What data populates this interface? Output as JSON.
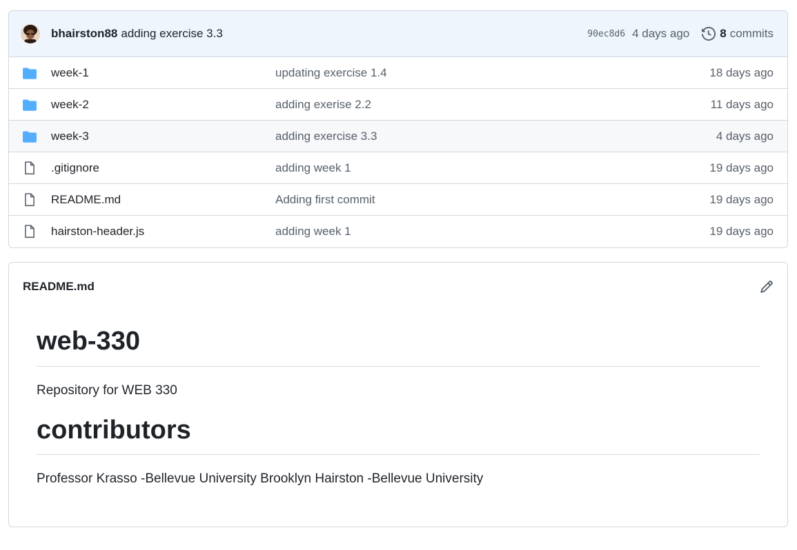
{
  "latest_commit": {
    "author": "bhairston88",
    "message": "adding exercise 3.3",
    "sha": "90ec8d6",
    "time": "4 days ago",
    "commit_count": "8",
    "commits_label": "commits"
  },
  "files": [
    {
      "type": "folder",
      "name": "week-1",
      "commit": "updating exercise 1.4",
      "age": "18 days ago"
    },
    {
      "type": "folder",
      "name": "week-2",
      "commit": "adding exerise 2.2",
      "age": "11 days ago"
    },
    {
      "type": "folder",
      "name": "week-3",
      "commit": "adding exercise 3.3",
      "age": "4 days ago"
    },
    {
      "type": "file",
      "name": ".gitignore",
      "commit": "adding week 1",
      "age": "19 days ago"
    },
    {
      "type": "file",
      "name": "README.md",
      "commit": "Adding first commit",
      "age": "19 days ago"
    },
    {
      "type": "file",
      "name": "hairston-header.js",
      "commit": "adding week 1",
      "age": "19 days ago"
    }
  ],
  "readme": {
    "filename": "README.md",
    "heading1": "web-330",
    "paragraph1": "Repository for WEB 330",
    "heading2": "contributors",
    "paragraph2": "Professor Krasso -Bellevue University Brooklyn Hairston -Bellevue University"
  },
  "colors": {
    "folder": "#54aeff",
    "file_icon": "#57606a",
    "header_bg": "#eef5fd"
  },
  "icons": {
    "folder": "folder-icon",
    "file": "file-icon",
    "history": "history-icon",
    "edit": "pencil-icon"
  }
}
